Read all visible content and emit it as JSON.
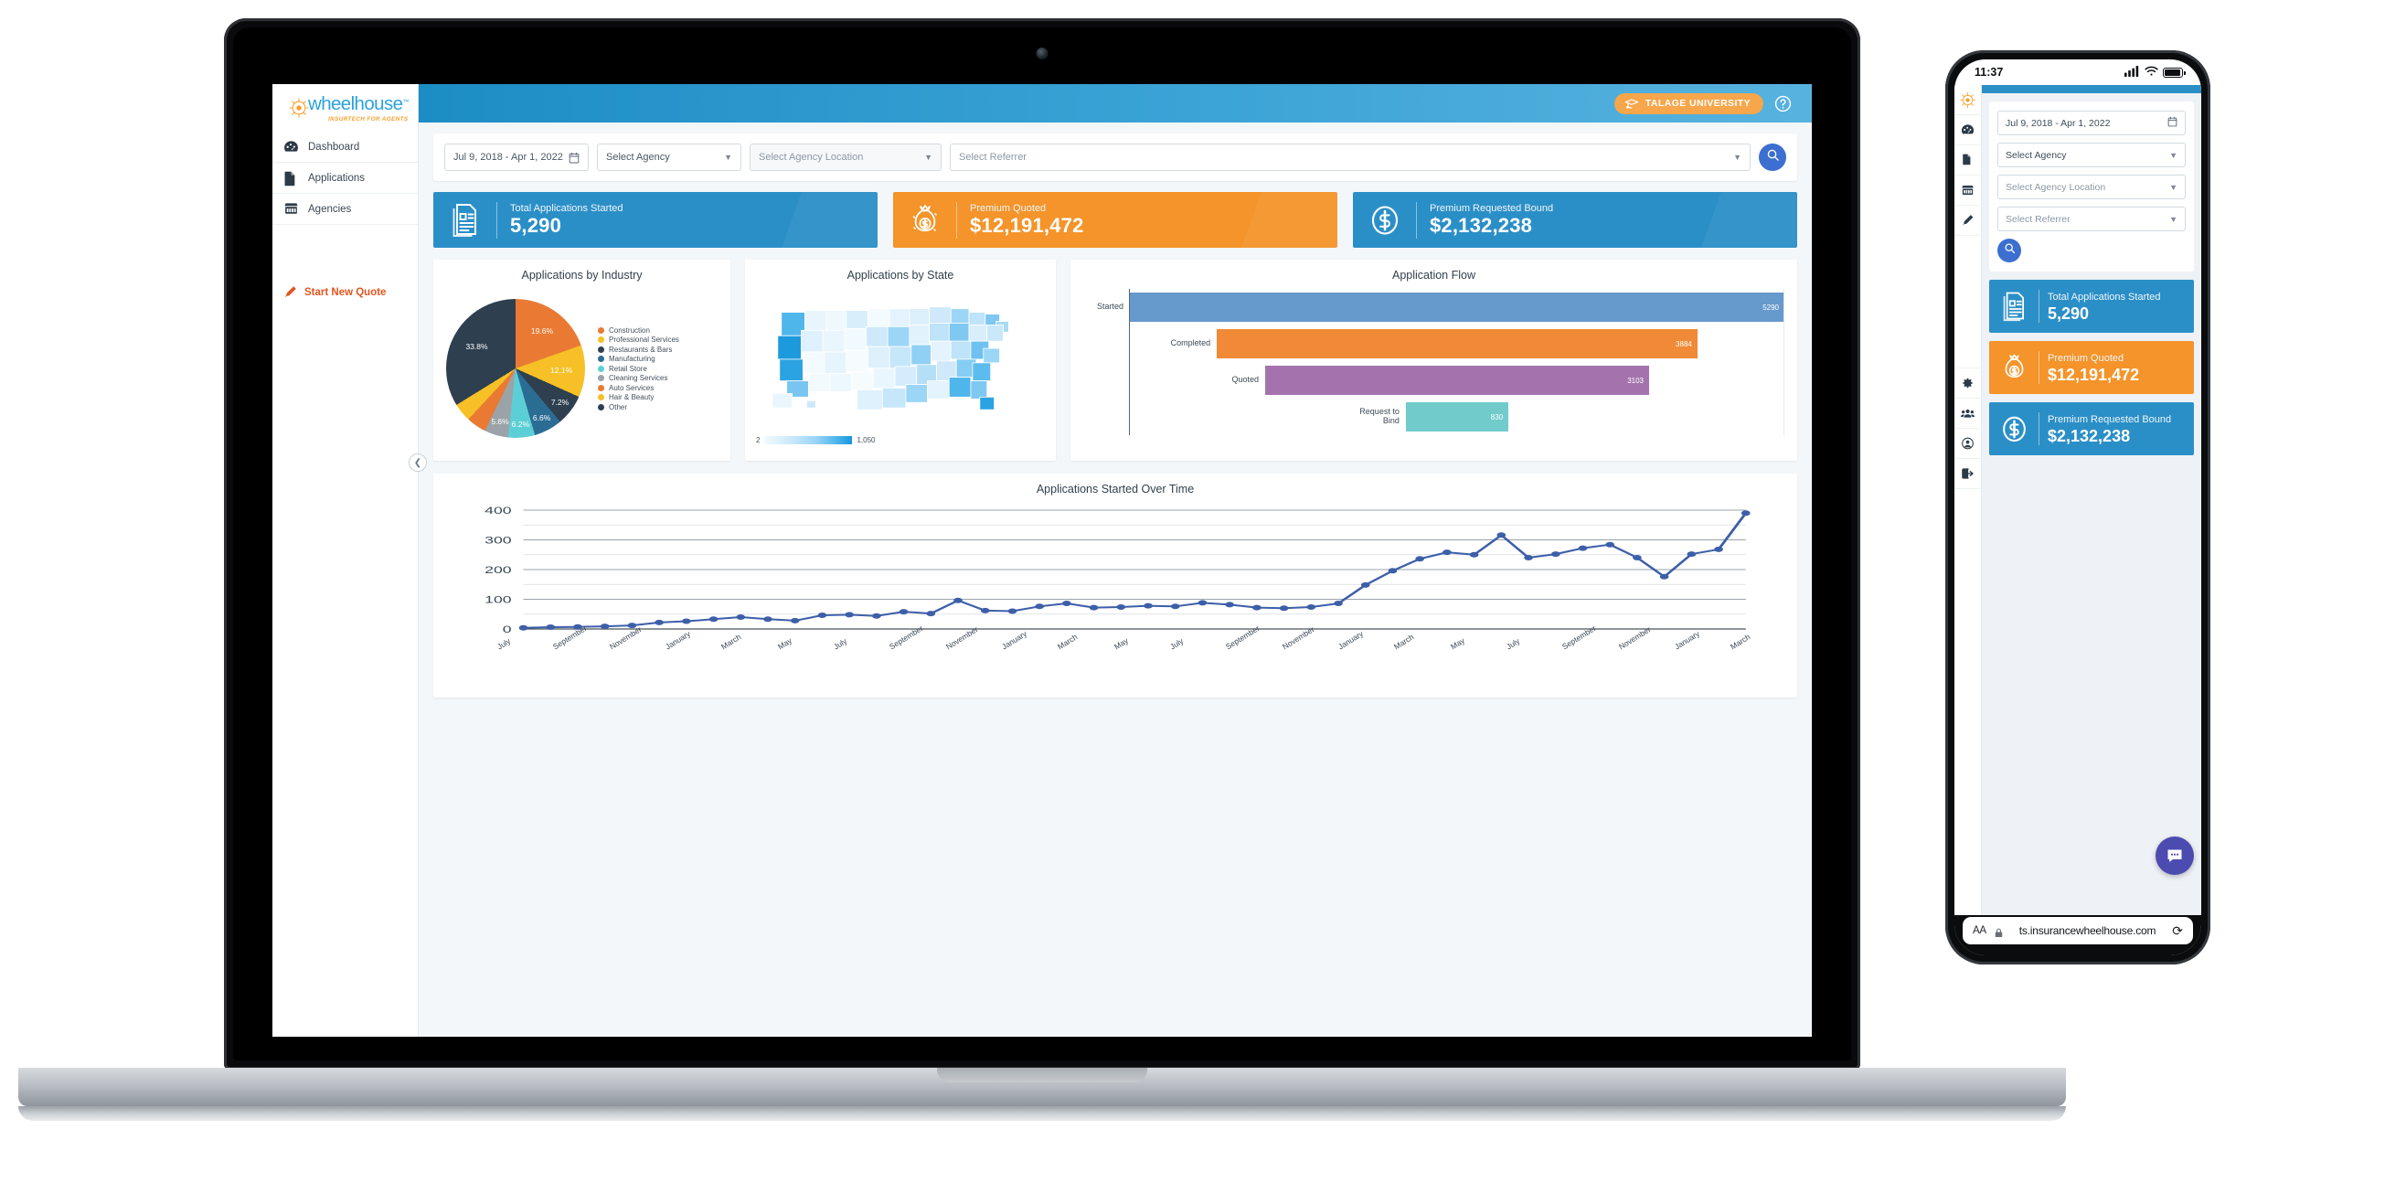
{
  "brand": {
    "logo_word": "wheelhouse",
    "logo_tm": "™",
    "logo_tagline": "INSURTECH FOR AGENTS",
    "accent_blue": "#2b8fc7",
    "accent_orange": "#f4942a",
    "logo_blue": "#2ba3dc",
    "logo_orange": "#f5a12a"
  },
  "sidebar": {
    "items": [
      {
        "label": "Dashboard",
        "icon": "gauge-icon",
        "active": true
      },
      {
        "label": "Applications",
        "icon": "documents-icon",
        "active": false
      },
      {
        "label": "Agencies",
        "icon": "storefront-icon",
        "active": false
      }
    ],
    "quote_link": {
      "label": "Start New Quote",
      "icon": "pencil-icon",
      "color": "#e2561f"
    },
    "collapse_icon": "chevron-left-icon"
  },
  "topbar": {
    "university_button": "TALAGE UNIVERSITY",
    "university_icon": "graduation-cap-icon",
    "help_icon": "help-circle-icon"
  },
  "filters": {
    "date_range": "Jul 9, 2018 - Apr 1, 2022",
    "calendar_icon": "calendar-icon",
    "agency": "Select Agency",
    "agency_location": "Select Agency Location",
    "referrer": "Select Referrer",
    "search_icon": "search-icon"
  },
  "kpis": [
    {
      "label": "Total Applications Started",
      "value": "5,290",
      "color": "blue",
      "icon": "documents-stack-icon"
    },
    {
      "label": "Premium Quoted",
      "value": "$12,191,472",
      "color": "orange",
      "icon": "money-bag-icon"
    },
    {
      "label": "Premium Requested Bound",
      "value": "$2,132,238",
      "color": "blue",
      "icon": "dollar-circle-icon"
    }
  ],
  "panels": {
    "industry_title": "Applications by Industry",
    "state_title": "Applications by State",
    "flow_title": "Application Flow",
    "timeline_title": "Applications Started Over Time"
  },
  "chart_data": [
    {
      "type": "pie",
      "title": "Applications by Industry",
      "legend_position": "right",
      "categories": [
        "Construction",
        "Professional Services",
        "Restaurants & Bars",
        "Manufacturing",
        "Retail Store",
        "Cleaning Services",
        "Auto Services",
        "Hair & Beauty",
        "Other"
      ],
      "values": [
        19.6,
        12.1,
        7.2,
        6.6,
        6.2,
        5.6,
        4.6,
        4.3,
        33.8
      ],
      "value_unit": "%",
      "labeled_slices": [
        "19.6%",
        "12.1%",
        "7.2%",
        "6.6%",
        "6.2%",
        "5.6%",
        "33.8%"
      ],
      "colors": [
        "#ea7a33",
        "#f6c026",
        "#2e3f4f",
        "#2b6c93",
        "#5ccfd6",
        "#9ba3a8",
        "#ea7a33",
        "#f6c026",
        "#2e3f4f"
      ]
    },
    {
      "type": "heatmap",
      "title": "Applications by State",
      "subtype": "choropleth-us-map",
      "legend_min": "2",
      "legend_max": "1,050",
      "color_scale": [
        "#f2fafe",
        "#cfeafb",
        "#9bd6f6",
        "#4fb6ec",
        "#1796dd"
      ]
    },
    {
      "type": "bar",
      "subtype": "funnel",
      "title": "Application Flow",
      "categories": [
        "Started",
        "Completed",
        "Quoted",
        "Request to Bind"
      ],
      "values": [
        5290,
        3884,
        3103,
        830
      ],
      "labels": [
        "5290",
        "3884",
        "3103",
        "830"
      ],
      "colors": [
        "#6699cc",
        "#f08a36",
        "#a473ad",
        "#72cbcb"
      ],
      "orientation": "horizontal-centered"
    },
    {
      "type": "line",
      "title": "Applications Started Over Time",
      "xlabel": "",
      "ylabel": "",
      "ylim": [
        0,
        400
      ],
      "yticks": [
        "0",
        "100",
        "200",
        "300",
        "400"
      ],
      "grid": true,
      "line_color": "#3d5fa8",
      "x_tick_labels": [
        "July",
        "September",
        "November",
        "January",
        "March",
        "May",
        "July",
        "September",
        "November",
        "January",
        "March",
        "May",
        "July",
        "September",
        "November",
        "January",
        "March",
        "May",
        "July",
        "September",
        "November",
        "January",
        "March"
      ],
      "values": [
        4,
        6,
        7,
        9,
        12,
        22,
        26,
        33,
        40,
        33,
        28,
        46,
        48,
        44,
        58,
        52,
        96,
        62,
        60,
        76,
        86,
        72,
        74,
        78,
        76,
        88,
        82,
        72,
        70,
        74,
        86,
        148,
        196,
        236,
        258,
        250,
        316,
        240,
        252,
        272,
        284,
        240,
        176,
        252,
        268,
        390
      ]
    }
  ],
  "phone": {
    "status_time": "11:37",
    "status_icons": [
      "cellular-icon",
      "wifi-icon",
      "battery-icon"
    ],
    "side_icons": [
      "wheel-logo-icon",
      "gauge-icon",
      "documents-icon",
      "storefront-icon",
      "pencil-icon",
      "gear-icon",
      "users-icon",
      "account-icon",
      "logout-icon"
    ],
    "filters": {
      "date_range": "Jul 9, 2018 - Apr 1, 2022",
      "agency": "Select Agency",
      "agency_location": "Select Agency Location",
      "referrer": "Select Referrer"
    },
    "kpis": [
      {
        "label": "Total Applications Started",
        "value": "5,290",
        "color": "blue"
      },
      {
        "label": "Premium Quoted",
        "value": "$12,191,472",
        "color": "orange"
      },
      {
        "label": "Premium Requested Bound",
        "value": "$2,132,238",
        "color": "blue"
      }
    ],
    "chat_icon": "chat-bubble-icon",
    "browser": {
      "text_size_label": "AA",
      "url": "ts.insurancewheelhouse.com",
      "lock_icon": "lock-icon",
      "reload_icon": "reload-icon"
    }
  }
}
